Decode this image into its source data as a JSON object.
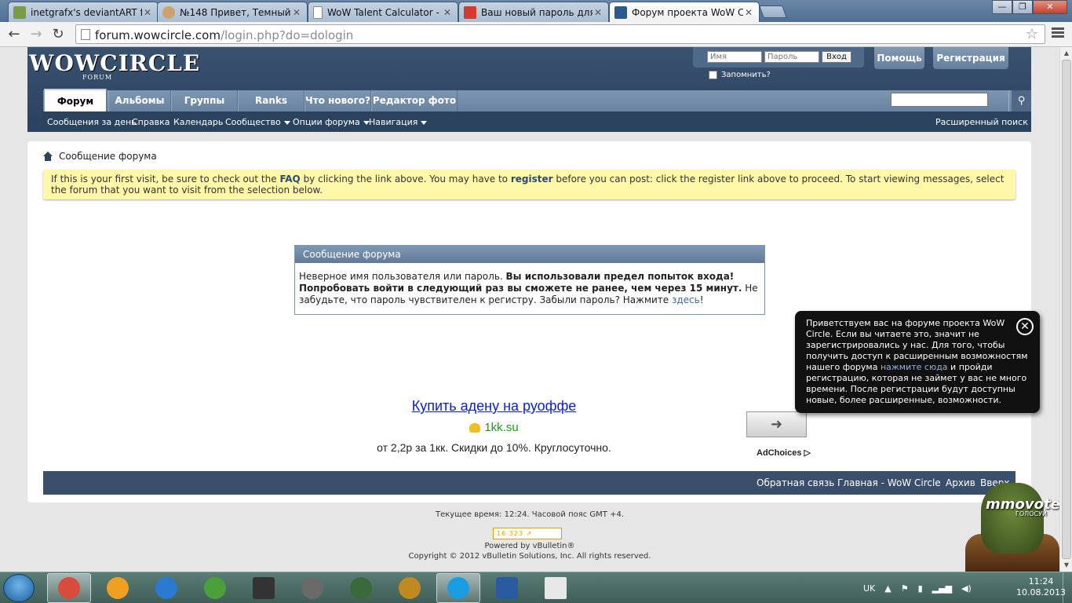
{
  "browser": {
    "tabs": [
      {
        "label": "inetgrafx's deviantART fav",
        "icon": "deviantart-icon",
        "color": "#7a9a4a"
      },
      {
        "label": "№148 Привет, Темный -",
        "icon": "face-icon",
        "color": "#c9a36b"
      },
      {
        "label": "WoW Talent Calculator - S",
        "icon": "document-icon",
        "color": "#ffffff"
      },
      {
        "label": "Ваш новый пароль для д",
        "icon": "gmail-icon",
        "color": "#d33b2c"
      },
      {
        "label": "Форум проекта WoW Circ",
        "icon": "wowcircle-icon",
        "color": "#2b5a8a"
      }
    ],
    "url_host": "forum.wowcircle.com",
    "url_path": "/login.php?do=dologin"
  },
  "header": {
    "logo": "WOWCIRCLE",
    "logo_sub": "FORUM",
    "username_placeholder": "Имя",
    "password_placeholder": "Пароль",
    "login_button": "Вход",
    "remember_label": "Запомнить?",
    "help_button": "Помощь",
    "register_button": "Регистрация"
  },
  "nav": {
    "tabs": [
      "Форум",
      "Альбомы",
      "Группы",
      "Ranks",
      "Что нового?",
      "Редактор фото"
    ],
    "sub": {
      "todays_posts": "Сообщения за день",
      "help": "Справка",
      "calendar": "Календарь",
      "community": "Сообщество",
      "forum_options": "Опции форума",
      "navigation": "Навигация",
      "advanced_search": "Расширенный поиск"
    }
  },
  "breadcrumb": "Сообщение форума",
  "notice": {
    "t1": "If this is your first visit, be sure to check out the ",
    "faq": "FAQ",
    "t2": " by clicking the link above. You may have to ",
    "register": "register",
    "t3": " before you can post: click the register link above to proceed. To start viewing messages, select the forum that you want to visit from the selection below."
  },
  "message": {
    "title": "Сообщение форума",
    "t1": "Неверное имя пользователя или пароль. ",
    "bold": "Вы использовали предел попыток входа! Попробовать войти в следующий раз вы сможете не ранее, чем через 15 минут.",
    "t2": " Не забудьте, что пароль чувствителен к регистру. Забыли пароль? Нажмите ",
    "link": "здесь",
    "t3": "!"
  },
  "ad": {
    "title": "Купить адену на руоффе",
    "domain": "1kk.su",
    "desc": "от 2,2р за 1кк. Скидки до 10%. Круглосуточно.",
    "adchoices": "AdChoices"
  },
  "footer": {
    "feedback": "Обратная связь",
    "home": "Главная - WoW Circle",
    "archive": "Архив",
    "top": "Вверх"
  },
  "bottom": {
    "time": "Текущее время: 12:24. Часовой пояс GMT +4.",
    "counter": "16 323",
    "powered": "Powered by vBulletin®",
    "copyright": "Copyright © 2012 vBulletin Solutions, Inc. All rights reserved."
  },
  "popup": {
    "t1": "Приветствуем вас на форуме проекта WoW Circle. Если вы читаете это, значит не зарегистрировались у нас. Для того, чтобы получить доступ к расширенным возможностям нашего форума ",
    "link": "нажмите сюда",
    "t2": " и пройди регистрацию, которая не займет у вас не много времени. После регистрации будут доступны новые, более расширенные, возможности."
  },
  "widget": {
    "brand": "mmovote",
    "sub": "ГОЛОСУЙ"
  },
  "taskbar": {
    "language": "UK",
    "time": "11:24",
    "date": "10.08.2013",
    "apps": [
      {
        "name": "chrome-icon",
        "color": "#d94c3d"
      },
      {
        "name": "aimp-icon",
        "color": "#f0a020"
      },
      {
        "name": "thunder-icon",
        "color": "#2a7ad0"
      },
      {
        "name": "utorrent-icon",
        "color": "#4aa03a"
      },
      {
        "name": "dx-icon",
        "color": "#333333"
      },
      {
        "name": "steam-icon",
        "color": "#6a6a6a"
      },
      {
        "name": "gw2-icon",
        "color": "#3a6a3a"
      },
      {
        "name": "wow-icon",
        "color": "#c08a20"
      },
      {
        "name": "skype-icon",
        "color": "#1a9de0"
      },
      {
        "name": "shield-icon",
        "color": "#2a5aa0"
      },
      {
        "name": "notepad-icon",
        "color": "#e8e8e8"
      }
    ]
  }
}
